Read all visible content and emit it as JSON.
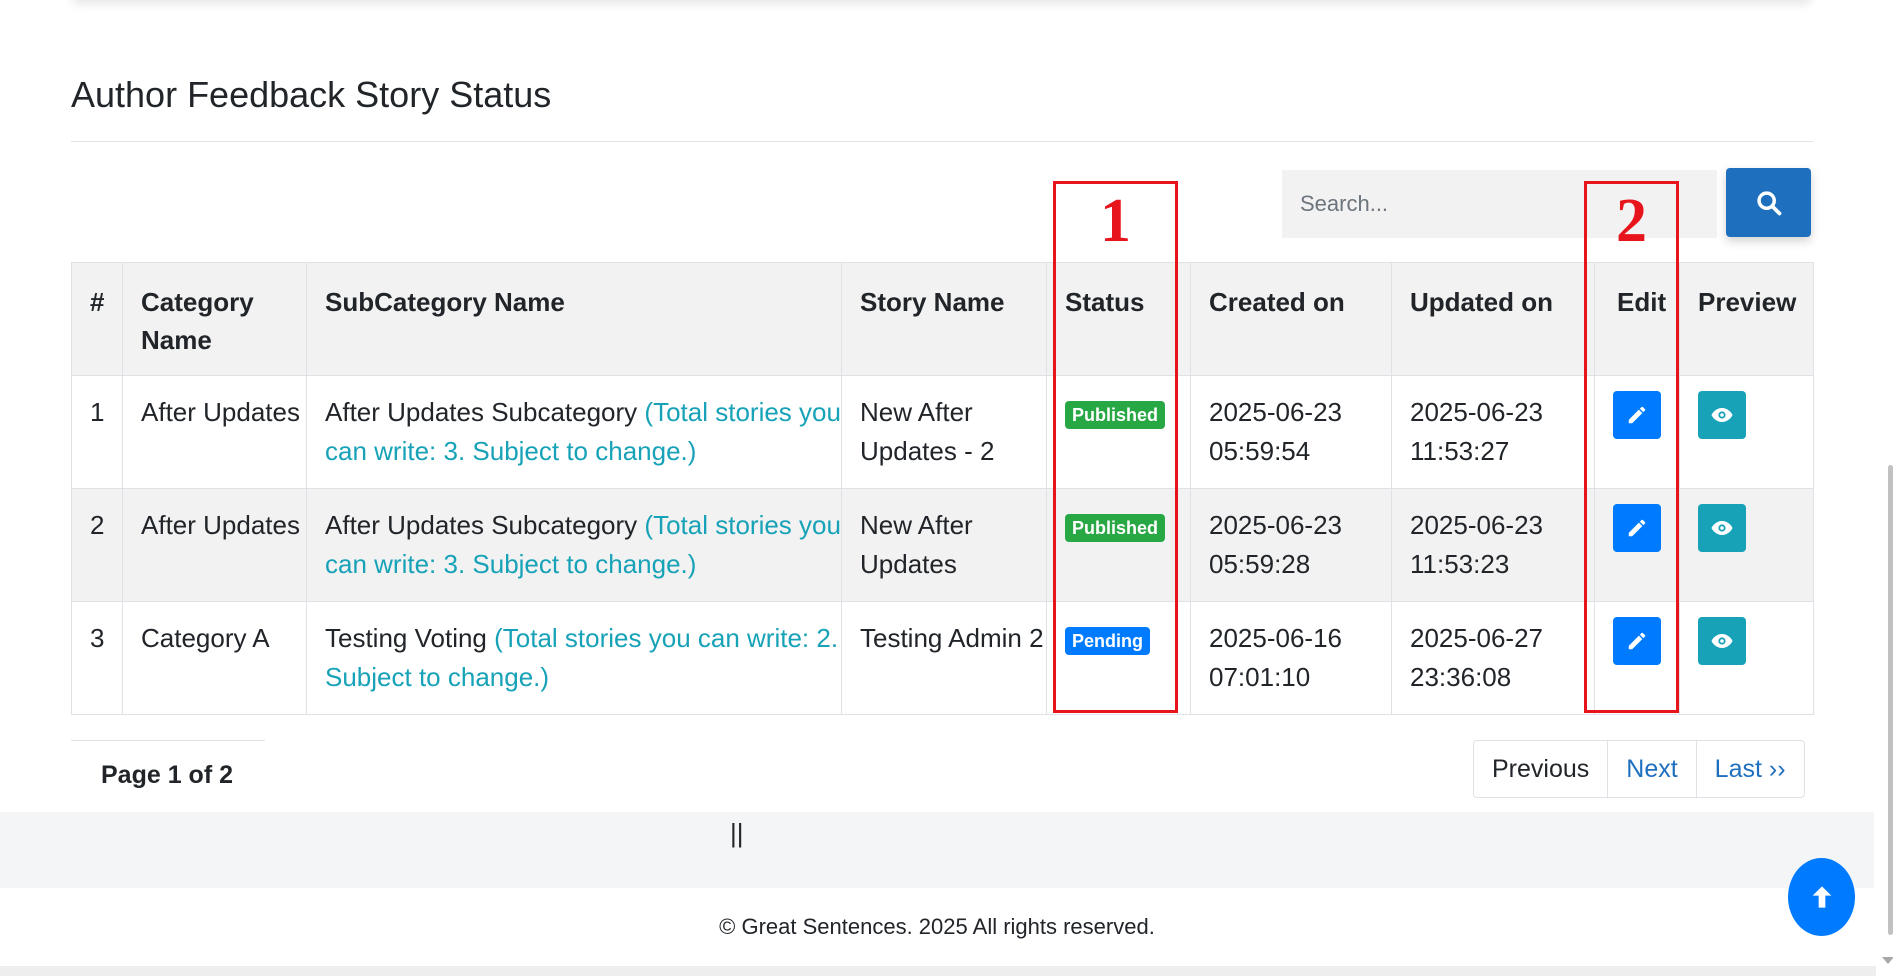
{
  "page": {
    "title": "Author Feedback Story Status"
  },
  "search": {
    "placeholder": "Search...",
    "button_icon": "search-icon"
  },
  "annotations": [
    "1",
    "2"
  ],
  "table": {
    "headers": {
      "num": "#",
      "category": "Category Name",
      "subcategory": "SubCategory Name",
      "story": "Story Name",
      "status": "Status",
      "created": "Created on",
      "updated": "Updated on",
      "edit": "Edit",
      "preview": "Preview"
    },
    "rows": [
      {
        "num": "1",
        "category": "After Updates",
        "subcategory": "After Updates Subcategory",
        "subcategory_note": "(Total stories you can write: 3. Subject to change.)",
        "story": "New After Updates - 2",
        "status": "Published",
        "created": "2025-06-23 05:59:54",
        "updated": "2025-06-23 11:53:27"
      },
      {
        "num": "2",
        "category": "After Updates",
        "subcategory": "After Updates Subcategory",
        "subcategory_note": "(Total stories you can write: 3. Subject to change.)",
        "story": "New After Updates",
        "status": "Published",
        "created": "2025-06-23 05:59:28",
        "updated": "2025-06-23 11:53:23"
      },
      {
        "num": "3",
        "category": "Category A",
        "subcategory": "Testing Voting",
        "subcategory_note": "(Total stories you can write: 2. Subject to change.)",
        "story": "Testing Admin 2",
        "status": "Pending",
        "created": "2025-06-16 07:01:10",
        "updated": "2025-06-27 23:36:08"
      }
    ]
  },
  "pagination": {
    "indicator": "Page 1 of 2",
    "previous": "Previous",
    "next": "Next",
    "last": "Last ››"
  },
  "divider_mark": "||",
  "footer": {
    "text": "© Great Sentences. 2025 All rights reserved."
  },
  "colors": {
    "primary": "#007bff",
    "info": "#17a2b8",
    "success": "#28a745",
    "search_button": "#1f6fbf",
    "annotation": "#e8141c"
  }
}
